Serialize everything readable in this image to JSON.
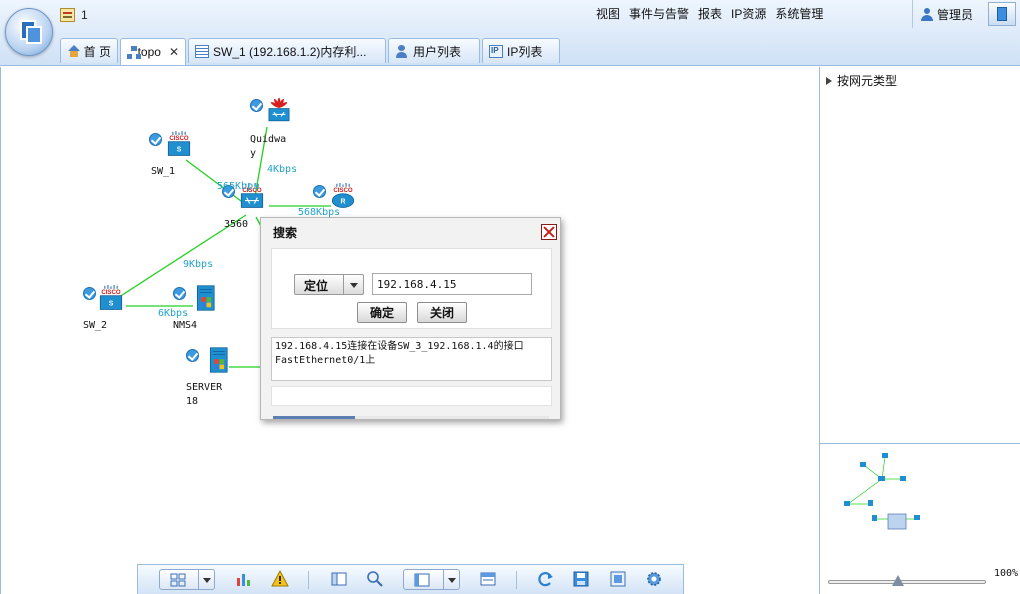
{
  "header": {
    "notification_count": "1",
    "nav": [
      "视图",
      "事件与告警",
      "报表",
      "IP资源",
      "系统管理"
    ],
    "user": "管理员"
  },
  "tabs": [
    {
      "label": "首 页",
      "icon": "home-icon",
      "closable": false
    },
    {
      "label": "topo",
      "icon": "topology-icon",
      "closable": true,
      "close_glyph": "✕",
      "active": true
    },
    {
      "label": "SW_1 (192.168.1.2)内存利...",
      "icon": "list-icon",
      "closable": false
    },
    {
      "label": "用户列表",
      "icon": "users-icon",
      "closable": false
    },
    {
      "label": "IP列表",
      "icon": "ip-list-icon",
      "closable": false
    }
  ],
  "topology": {
    "nodes": {
      "quidway": {
        "label": "Quidwa\ny",
        "type": "switch",
        "vendor": "huawei"
      },
      "sw1": {
        "label": "SW_1",
        "type": "switch",
        "vendor": "cisco",
        "vendor_text": "CISCO",
        "badge": "S"
      },
      "c3560": {
        "label": "3560",
        "type": "router-switch",
        "vendor": "cisco",
        "vendor_text": "CISCO"
      },
      "router": {
        "label": "",
        "type": "router",
        "vendor": "cisco",
        "vendor_text": "CISCO",
        "badge": "R"
      },
      "sw2": {
        "label": "SW_2",
        "type": "switch",
        "vendor": "cisco",
        "vendor_text": "CISCO",
        "badge": "S"
      },
      "nms4": {
        "label": "NMS4",
        "type": "server"
      },
      "server18": {
        "label": "SERVER\n18",
        "type": "server"
      }
    },
    "links": [
      {
        "from": "sw1",
        "to": "c3560",
        "speed": "565Kbps"
      },
      {
        "from": "quidway",
        "to": "c3560",
        "speed": "4Kbps"
      },
      {
        "from": "c3560",
        "to": "router",
        "speed": "568Kbps"
      },
      {
        "from": "c3560",
        "to": "sw2",
        "speed": "9Kbps"
      },
      {
        "from": "sw2",
        "to": "nms4",
        "speed": "6Kbps"
      },
      {
        "from": "c3560",
        "to": "server18",
        "speed": ""
      }
    ],
    "link_color": "#22d020",
    "speed_color": "#21a3c9"
  },
  "dialog": {
    "title": "搜索",
    "locate_label": "定位",
    "ip_value": "192.168.4.15",
    "ok_label": "确定",
    "close_label": "关闭",
    "result": "192.168.4.15连接在设备SW_3_192.168.1.4的接口FastEthernet0/1上"
  },
  "rightpanel": {
    "tree_root": "按网元类型",
    "zoom": "100%"
  },
  "toolbar": {
    "items": [
      "layout-icon",
      "chart-icon",
      "warning-icon",
      "panel-icon",
      "search-icon",
      "view-icon",
      "window-icon",
      "refresh-icon",
      "save-icon",
      "export-icon",
      "settings-icon"
    ]
  }
}
